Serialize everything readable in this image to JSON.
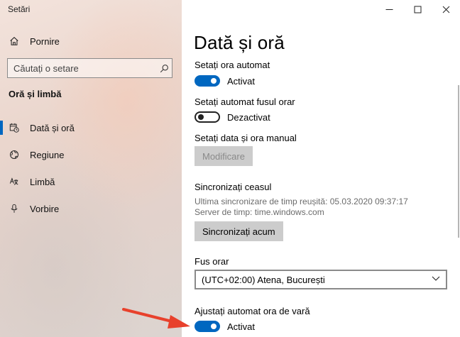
{
  "app": {
    "title": "Setări"
  },
  "sidebar": {
    "home_label": "Pornire",
    "search_placeholder": "Căutați o setare",
    "section_label": "Oră și limbă",
    "items": [
      {
        "label": "Dată și oră",
        "icon": "calendar-clock-icon",
        "active": true
      },
      {
        "label": "Regiune",
        "icon": "globe-icon",
        "active": false
      },
      {
        "label": "Limbă",
        "icon": "language-icon",
        "active": false
      },
      {
        "label": "Vorbire",
        "icon": "microphone-icon",
        "active": false
      }
    ]
  },
  "main": {
    "title": "Dată și oră",
    "auto_time": {
      "label": "Setați ora automat",
      "state": "Activat"
    },
    "auto_timezone": {
      "label": "Setați automat fusul orar",
      "state": "Dezactivat"
    },
    "manual": {
      "label": "Setați data și ora manual",
      "button": "Modificare"
    },
    "sync": {
      "label": "Sincronizați ceasul",
      "last_sync": "Ultima sincronizare de timp reușită: 05.03.2020 09:37:17",
      "server": "Server de timp: time.windows.com",
      "button": "Sincronizați acum"
    },
    "timezone": {
      "label": "Fus orar",
      "value": "(UTC+02:00) Atena, București"
    },
    "dst": {
      "label": "Ajustați automat ora de vară",
      "state": "Activat"
    }
  },
  "colors": {
    "accent": "#0067c0",
    "annotation_arrow": "#e8412c"
  }
}
